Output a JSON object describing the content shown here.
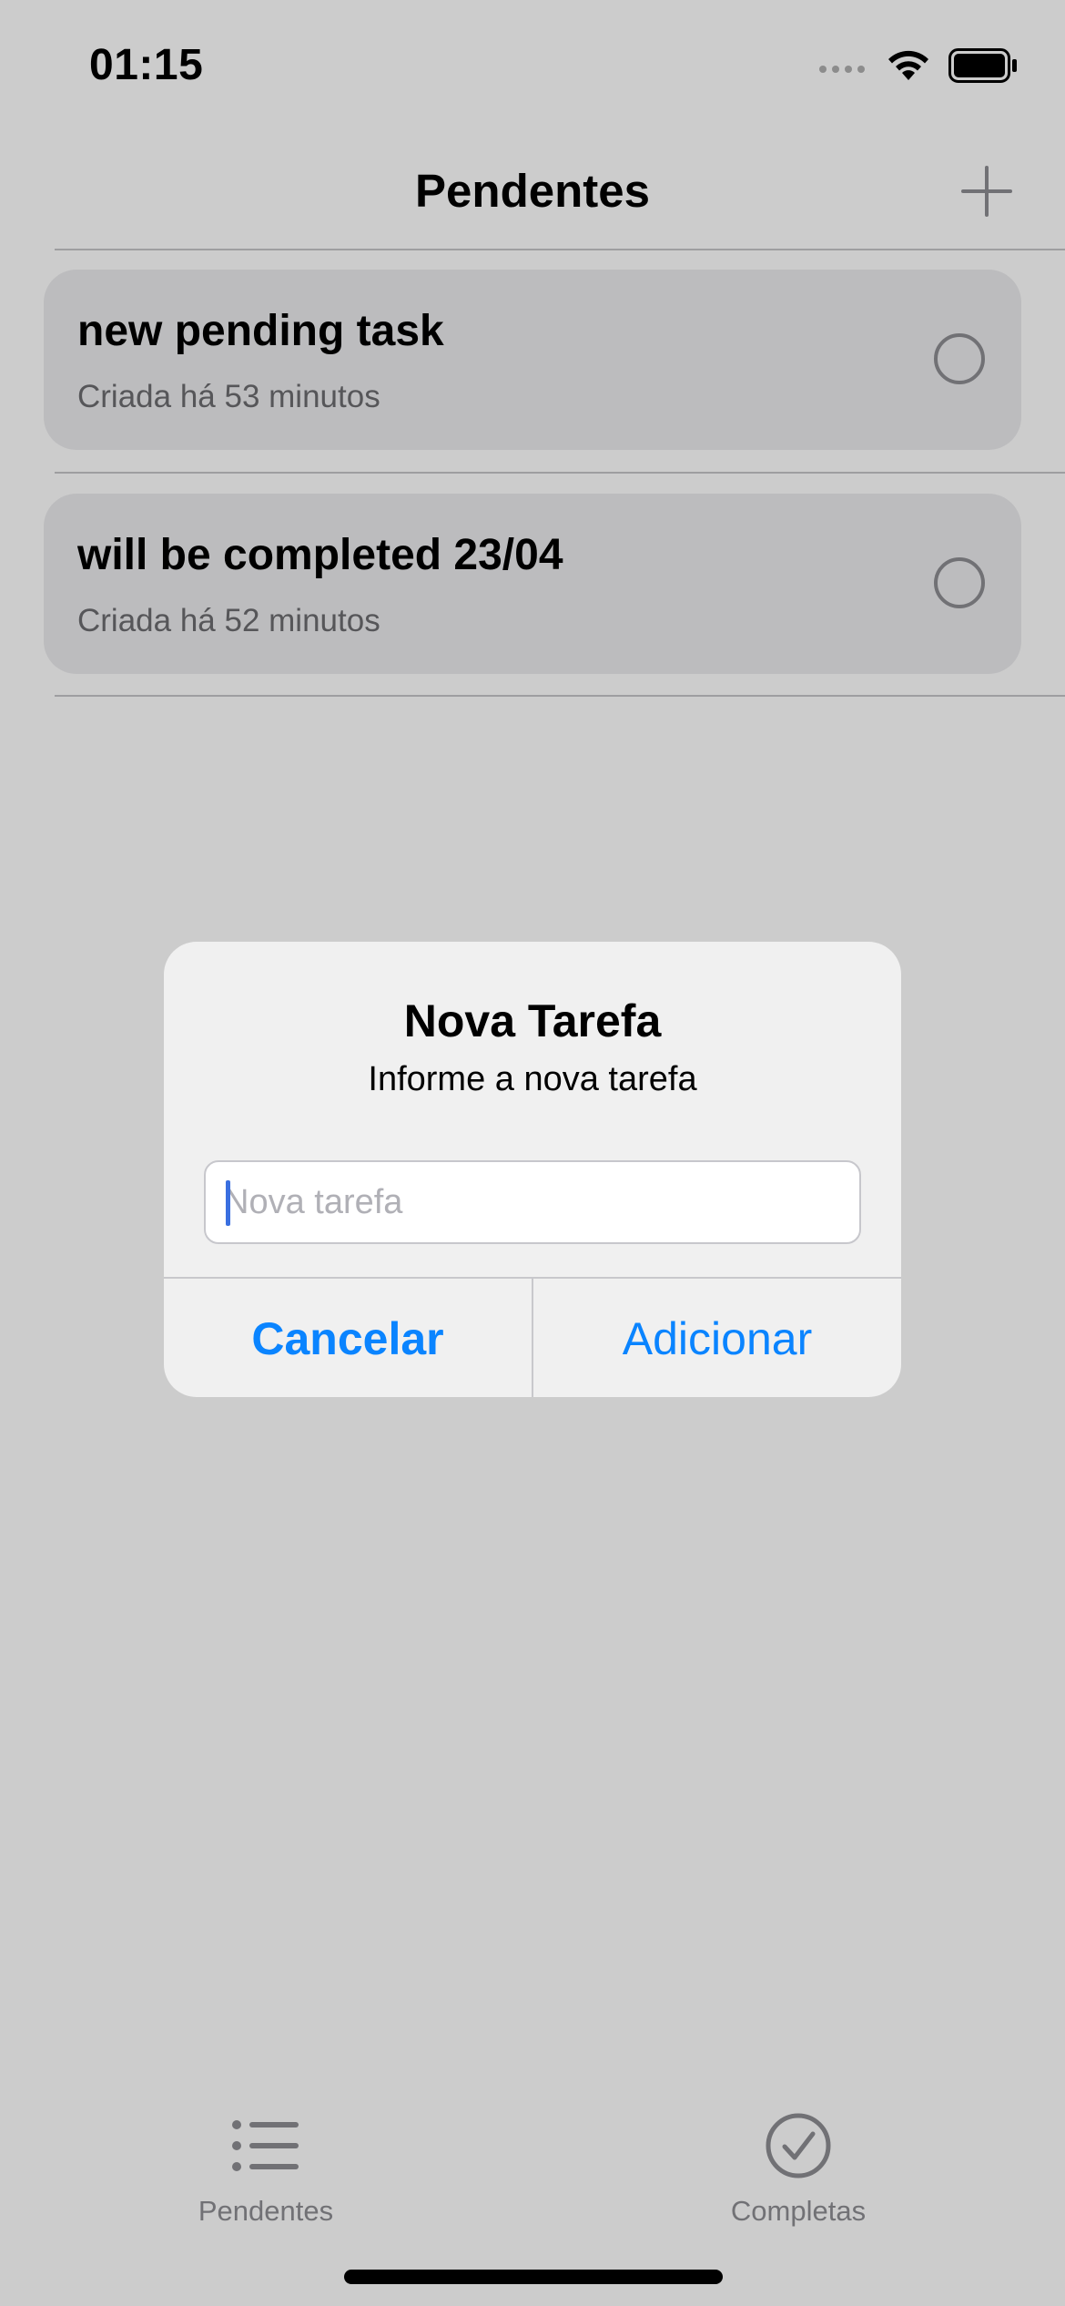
{
  "status_bar": {
    "time": "01:15",
    "icons": [
      "cellular-signal-icon",
      "wifi-icon",
      "battery-icon"
    ]
  },
  "nav": {
    "title": "Pendentes",
    "add_icon": "plus-icon"
  },
  "tasks": [
    {
      "title": "new pending task",
      "subtitle": "Criada há 53 minutos"
    },
    {
      "title": "will be completed 23/04",
      "subtitle": "Criada há 52 minutos"
    }
  ],
  "alert": {
    "title": "Nova Tarefa",
    "message": "Informe a nova tarefa",
    "input_placeholder": "Nova tarefa",
    "input_value": "",
    "cancel_label": "Cancelar",
    "confirm_label": "Adicionar"
  },
  "tabs": [
    {
      "label": "Pendentes",
      "icon": "list-icon"
    },
    {
      "label": "Completas",
      "icon": "checkmark-circle-icon"
    }
  ],
  "colors": {
    "accent": "#0a84ff",
    "secondary_text": "#8e8e93",
    "card_background": "#ececee"
  }
}
